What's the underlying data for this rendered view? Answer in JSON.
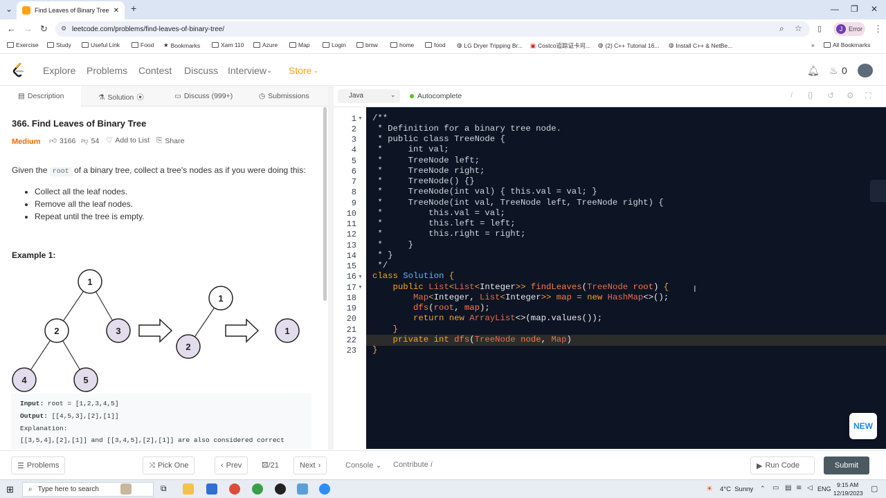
{
  "browser": {
    "tab_title": "Find Leaves of Binary Tree - Lee",
    "url": "leetcode.com/problems/find-leaves-of-binary-tree/",
    "profile_letter": "J",
    "profile_label": "Error",
    "bookmarks": [
      "Exercise",
      "Study",
      "Useful Link",
      "Food",
      "Bookmarks",
      "Xam 110",
      "Azure",
      "Map",
      "Login",
      "bmw",
      "home",
      "food",
      "LG Dryer Tripping Br...",
      "Costco追踪证卡司...",
      "(2) C++ Tutorial 16...",
      "Install C++ & NetBe...",
      "All Bookmarks"
    ]
  },
  "header": {
    "nav": [
      "Explore",
      "Problems",
      "Contest",
      "Discuss",
      "Interview",
      "Store"
    ],
    "streak": "0"
  },
  "left_tabs": [
    "Description",
    "Solution",
    "Discuss (999+)",
    "Submissions"
  ],
  "problem": {
    "title": "366. Find Leaves of Binary Tree",
    "difficulty": "Medium",
    "likes": "3166",
    "dislikes": "54",
    "add_to_list": "Add to List",
    "share": "Share",
    "desc_before": "Given the",
    "desc_code": "root",
    "desc_after": "of a binary tree, collect a tree's nodes as if you were doing this:",
    "bullets": [
      "Collect all the leaf nodes.",
      "Remove all the leaf nodes.",
      "Repeat until the tree is empty."
    ],
    "example_title": "Example 1:",
    "tree_nodes": [
      "1",
      "2",
      "3",
      "4",
      "5",
      "1",
      "2",
      "1"
    ],
    "input_label": "Input:",
    "input_value": "root = [1,2,3,4,5]",
    "output_label": "Output:",
    "output_value": "[[4,5,3],[2],[1]]",
    "explanation_label": "Explanation:",
    "explanation_text": "[[3,5,4],[2],[1]] and [[3,4,5],[2],[1]] are also considered correct"
  },
  "editor": {
    "language": "Java",
    "autocomplete": "Autocomplete",
    "line_numbers": [
      "1",
      "2",
      "3",
      "4",
      "5",
      "6",
      "7",
      "8",
      "9",
      "10",
      "11",
      "12",
      "13",
      "14",
      "15",
      "16",
      "17",
      "18",
      "19",
      "20",
      "21",
      "22",
      "23"
    ]
  },
  "bottom": {
    "problems": "Problems",
    "pick_one": "Pick One",
    "prev": "Prev",
    "page": "/21",
    "next": "Next",
    "console": "Console",
    "contribute": "Contribute",
    "run_code": "Run Code",
    "submit": "Submit",
    "new_badge": "NEW"
  },
  "taskbar": {
    "search_placeholder": "Type here to search",
    "weather": "4°C  Sunny",
    "lang": "ENG",
    "time": "9:15 AM",
    "date": "12/19/2023"
  },
  "colors": {
    "accent": "#ffa116",
    "medium": "#ef6c00",
    "editor_bg": "#0d1424",
    "submit_bg": "#4a5a60"
  }
}
